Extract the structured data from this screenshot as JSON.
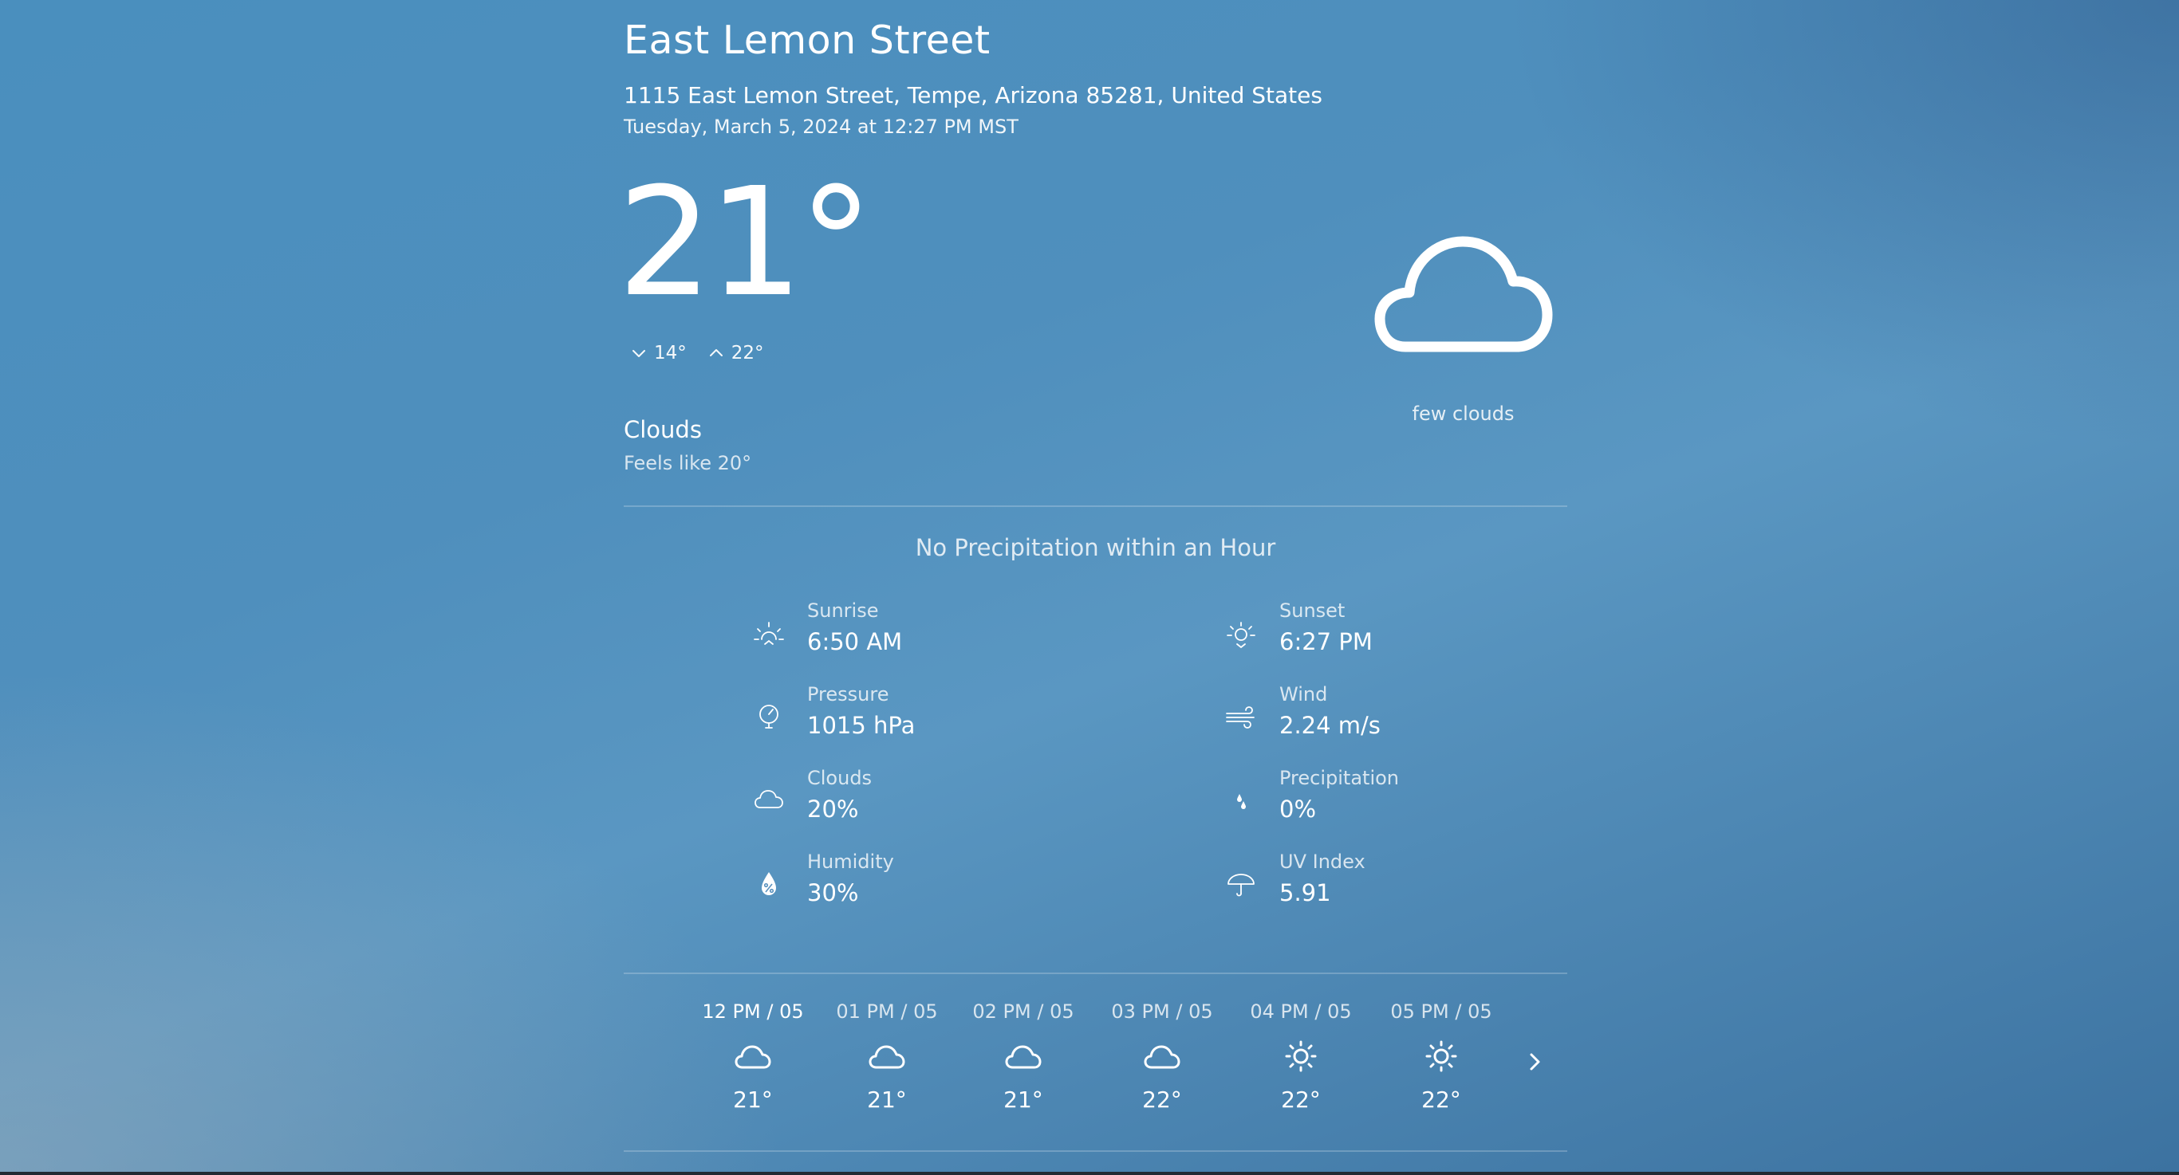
{
  "header": {
    "location_name": "East Lemon Street",
    "address": "1115 East Lemon Street, Tempe, Arizona 85281, United States",
    "datetime": "Tuesday, March 5, 2024 at 12:27 PM MST"
  },
  "current": {
    "temperature": "21°",
    "low": "14°",
    "high": "22°",
    "condition": "Clouds",
    "feels_like": "Feels like 20°",
    "icon": "cloud-icon",
    "description": "few clouds"
  },
  "precipitation_note": "No Precipitation within an Hour",
  "details": [
    {
      "label": "Sunrise",
      "value": "6:50 AM",
      "icon": "sunrise-icon"
    },
    {
      "label": "Sunset",
      "value": "6:27 PM",
      "icon": "sunset-icon"
    },
    {
      "label": "Pressure",
      "value": "1015 hPa",
      "icon": "pressure-gauge-icon"
    },
    {
      "label": "Wind",
      "value": "2.24 m/s",
      "icon": "wind-icon"
    },
    {
      "label": "Clouds",
      "value": "20%",
      "icon": "cloud-icon"
    },
    {
      "label": "Precipitation",
      "value": "0%",
      "icon": "raindrops-icon"
    },
    {
      "label": "Humidity",
      "value": "30%",
      "icon": "humidity-drop-icon"
    },
    {
      "label": "UV Index",
      "value": "5.91",
      "icon": "umbrella-icon"
    }
  ],
  "hourly": [
    {
      "time": "12 PM / 05",
      "temp": "21°",
      "icon": "cloud-icon"
    },
    {
      "time": "01 PM / 05",
      "temp": "21°",
      "icon": "cloud-icon"
    },
    {
      "time": "02 PM / 05",
      "temp": "21°",
      "icon": "cloud-icon"
    },
    {
      "time": "03 PM / 05",
      "temp": "22°",
      "icon": "cloud-icon"
    },
    {
      "time": "04 PM / 05",
      "temp": "22°",
      "icon": "sun-icon"
    },
    {
      "time": "05 PM / 05",
      "temp": "22°",
      "icon": "sun-icon"
    }
  ],
  "hourly_next_icon": "chevron-right-icon",
  "colors": {
    "background_top": "#4a8fbe",
    "background_bottom": "#3c72a0",
    "text": "#ffffff"
  }
}
